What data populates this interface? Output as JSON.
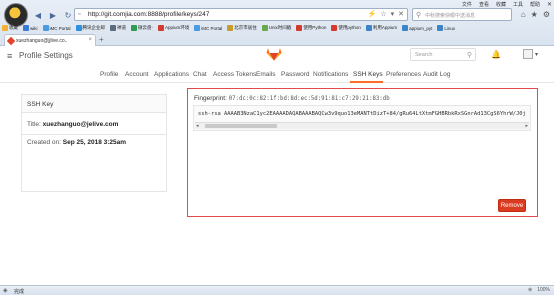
{
  "browser": {
    "address": "http://git.comjia.com:8888/profile/keys/247",
    "search_placeholder": "中秋搜索快眼中送消息",
    "menu": [
      "文件",
      "查看",
      "收藏",
      "工具",
      "帮助"
    ],
    "bookmarks": [
      {
        "label": "收藏",
        "color": "#f2b233"
      },
      {
        "label": "wiki",
        "color": "#3b7bd4"
      },
      {
        "label": "iMC Portal",
        "color": "#4a9be0"
      },
      {
        "label": "腾讯企业邮",
        "color": "#2d8fe0"
      },
      {
        "label": "禅道",
        "color": "#5a6b7d"
      },
      {
        "label": "微云盘·",
        "color": "#2e9d4e"
      },
      {
        "label": "Appium环境",
        "color": "#d53a2f"
      },
      {
        "label": "iMC Portal",
        "color": "#4a9be0"
      },
      {
        "label": "北京市居住",
        "color": "#c89b2a"
      },
      {
        "label": "Unix时间戳",
        "color": "#6aa84f"
      },
      {
        "label": "使用Python",
        "color": "#d53a2f"
      },
      {
        "label": "使用python",
        "color": "#d53a2f"
      },
      {
        "label": "利用Appium",
        "color": "#3d85c6"
      },
      {
        "label": "appium_pyt",
        "color": "#3d85c6"
      },
      {
        "label": "Linux",
        "color": "#3d85c6"
      }
    ],
    "tab_title": "xuezhanguo@jjlive.co..",
    "status_text": "完成",
    "zoom": "100%"
  },
  "gitlab": {
    "page_title": "Profile Settings",
    "search_placeholder": "Search",
    "subnav": [
      {
        "label": "Profile",
        "active": false
      },
      {
        "label": "Account",
        "active": false
      },
      {
        "label": "Applications",
        "active": false
      },
      {
        "label": "Chat",
        "active": false
      },
      {
        "label": "Access Tokens",
        "active": false
      },
      {
        "label": "Emails",
        "active": false
      },
      {
        "label": "Password",
        "active": false
      },
      {
        "label": "Notifications",
        "active": false
      },
      {
        "label": "SSH Keys",
        "active": true
      },
      {
        "label": "Preferences",
        "active": false
      },
      {
        "label": "Audit Log",
        "active": false
      }
    ],
    "card": {
      "header": "SSH Key",
      "title_label": "Title:",
      "title_value": "xuezhanguo@jelive.com",
      "created_label": "Created on:",
      "created_value": "Sep 25, 2018 3:25am"
    },
    "key": {
      "fingerprint_label": "Fingerprint:",
      "fingerprint_value": "07:dc:0c:82:1f:bd:8d:ec:5d:91:81:c7:29:21:83:db",
      "public_key": "ssh-rsa AAAAB3NzaC1yc2EAAAADAQABAAABAQCw3v9quo13eMANTtDizT+84/gRu64LtXtmFGHBRbkRxSGnrAd13CgS6YhrW/J0j",
      "remove_label": "Remove"
    }
  }
}
